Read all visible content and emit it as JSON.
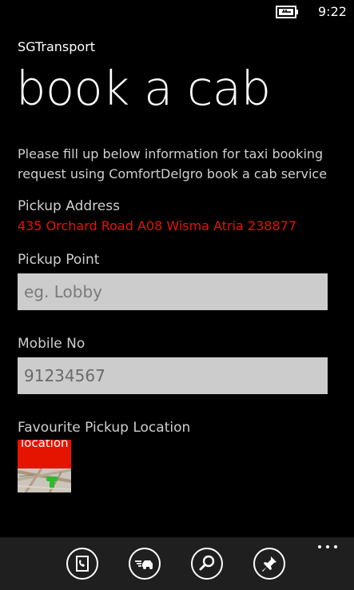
{
  "status_bar": {
    "time": "9:22",
    "battery_icon": "battery-charging-icon"
  },
  "app": {
    "name": "SGTransport",
    "page_title": "book a cab",
    "description": "Please fill up below information for taxi booking request using ComfortDelgro book a cab service"
  },
  "form": {
    "pickup_address_label": "Pickup Address",
    "pickup_address_value": "435 Orchard Road A08 Wisma Atria 238877",
    "pickup_point_label": "Pickup Point",
    "pickup_point_placeholder": "eg. Lobby",
    "pickup_point_value": "",
    "mobile_label": "Mobile No",
    "mobile_value": "91234567",
    "favourite_label": "Favourite Pickup Location",
    "favourite_tile_text": "location"
  },
  "app_bar": {
    "buttons": [
      {
        "icon": "phone-book-icon"
      },
      {
        "icon": "taxi-icon"
      },
      {
        "icon": "search-icon"
      },
      {
        "icon": "pin-icon"
      }
    ],
    "more_icon": "more-options-icon"
  },
  "colors": {
    "accent": "#e51400",
    "background": "#000000",
    "input_background": "#cccccc",
    "app_bar": "#1f1f1f"
  }
}
